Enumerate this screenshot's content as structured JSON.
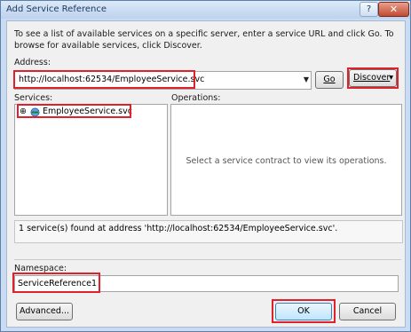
{
  "window": {
    "title": "Add Service Reference",
    "help_glyph": "?",
    "close_glyph": "✕"
  },
  "intro_text": "To see a list of available services on a specific server, enter a service URL and click Go. To browse for available services, click Discover.",
  "address": {
    "label": "Address:",
    "value": "http://localhost:62534/EmployeeService.svc",
    "dropdown_glyph": "▼",
    "go_label": "Go",
    "discover_label": "Discover",
    "discover_arrow": "▾"
  },
  "services": {
    "label": "Services:",
    "items": [
      {
        "name": "EmployeeService.svc",
        "expand_glyph": "⊕"
      }
    ]
  },
  "operations": {
    "label": "Operations:",
    "placeholder": "Select a service contract to view its operations."
  },
  "status": "1 service(s) found at address 'http://localhost:62534/EmployeeService.svc'.",
  "namespace": {
    "label": "Namespace:",
    "value": "ServiceReference1"
  },
  "buttons": {
    "advanced": "Advanced...",
    "ok": "OK",
    "cancel": "Cancel"
  },
  "colors": {
    "highlight": "#e0202a",
    "title_bar": "#c9dcf2",
    "close_button": "#c24b32"
  }
}
